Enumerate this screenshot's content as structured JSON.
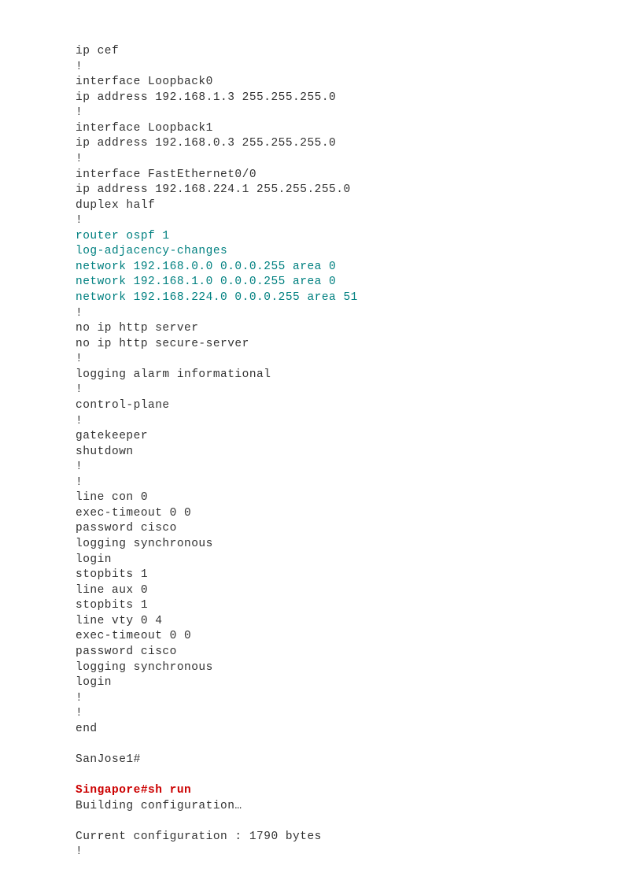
{
  "lines": [
    {
      "text": "ip cef",
      "style": "normal"
    },
    {
      "text": "!",
      "style": "normal"
    },
    {
      "text": "interface Loopback0",
      "style": "normal"
    },
    {
      "text": "ip address 192.168.1.3 255.255.255.0",
      "style": "normal"
    },
    {
      "text": "!",
      "style": "normal"
    },
    {
      "text": "interface Loopback1",
      "style": "normal"
    },
    {
      "text": "ip address 192.168.0.3 255.255.255.0",
      "style": "normal"
    },
    {
      "text": "!",
      "style": "normal"
    },
    {
      "text": "interface FastEthernet0/0",
      "style": "normal"
    },
    {
      "text": "ip address 192.168.224.1 255.255.255.0",
      "style": "normal"
    },
    {
      "text": "duplex half",
      "style": "normal"
    },
    {
      "text": "!",
      "style": "normal"
    },
    {
      "text": "router ospf 1",
      "style": "teal"
    },
    {
      "text": "log-adjacency-changes",
      "style": "teal"
    },
    {
      "text": "network 192.168.0.0 0.0.0.255 area 0",
      "style": "teal"
    },
    {
      "text": "network 192.168.1.0 0.0.0.255 area 0",
      "style": "teal"
    },
    {
      "text": "network 192.168.224.0 0.0.0.255 area 51",
      "style": "teal"
    },
    {
      "text": "!",
      "style": "normal"
    },
    {
      "text": "no ip http server",
      "style": "normal"
    },
    {
      "text": "no ip http secure-server",
      "style": "normal"
    },
    {
      "text": "!",
      "style": "normal"
    },
    {
      "text": "logging alarm informational",
      "style": "normal"
    },
    {
      "text": "!",
      "style": "normal"
    },
    {
      "text": "control-plane",
      "style": "normal"
    },
    {
      "text": "!",
      "style": "normal"
    },
    {
      "text": "gatekeeper",
      "style": "normal"
    },
    {
      "text": "shutdown",
      "style": "normal"
    },
    {
      "text": "!",
      "style": "normal"
    },
    {
      "text": "!",
      "style": "normal"
    },
    {
      "text": "line con 0",
      "style": "normal"
    },
    {
      "text": "exec-timeout 0 0",
      "style": "normal"
    },
    {
      "text": "password cisco",
      "style": "normal"
    },
    {
      "text": "logging synchronous",
      "style": "normal"
    },
    {
      "text": "login",
      "style": "normal"
    },
    {
      "text": "stopbits 1",
      "style": "normal"
    },
    {
      "text": "line aux 0",
      "style": "normal"
    },
    {
      "text": "stopbits 1",
      "style": "normal"
    },
    {
      "text": "line vty 0 4",
      "style": "normal"
    },
    {
      "text": "exec-timeout 0 0",
      "style": "normal"
    },
    {
      "text": "password cisco",
      "style": "normal"
    },
    {
      "text": "logging synchronous",
      "style": "normal"
    },
    {
      "text": "login",
      "style": "normal"
    },
    {
      "text": "!",
      "style": "normal"
    },
    {
      "text": "!",
      "style": "normal"
    },
    {
      "text": "end",
      "style": "normal"
    },
    {
      "text": "",
      "style": "blank"
    },
    {
      "text": "SanJose1#",
      "style": "normal"
    },
    {
      "text": "",
      "style": "blank"
    },
    {
      "text": "Singapore#sh run",
      "style": "red"
    },
    {
      "text": "Building configuration…",
      "style": "normal"
    },
    {
      "text": "",
      "style": "blank"
    },
    {
      "text": "Current configuration : 1790 bytes",
      "style": "normal"
    },
    {
      "text": "!",
      "style": "normal"
    }
  ]
}
